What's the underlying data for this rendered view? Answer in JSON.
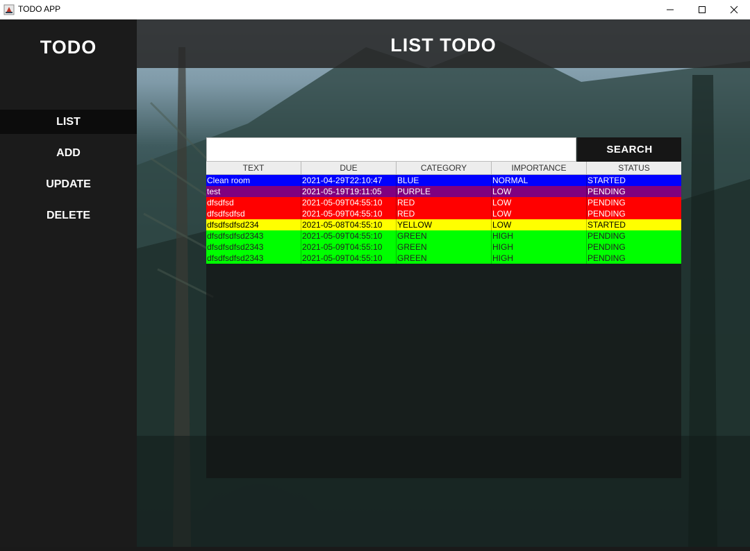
{
  "window": {
    "title": "TODO APP"
  },
  "sidebar": {
    "brand": "TODO",
    "items": [
      {
        "label": "LIST",
        "active": true
      },
      {
        "label": "ADD",
        "active": false
      },
      {
        "label": "UPDATE",
        "active": false
      },
      {
        "label": "DELETE",
        "active": false
      }
    ]
  },
  "main": {
    "title": "LIST TODO",
    "search": {
      "value": "",
      "button_label": "SEARCH"
    }
  },
  "table": {
    "columns": [
      "TEXT",
      "DUE",
      "CATEGORY",
      "IMPORTANCE",
      "STATUS"
    ],
    "rows": [
      {
        "cells": [
          "Clean room",
          "2021-04-29T22:10:47",
          "BLUE",
          "NORMAL",
          "STARTED"
        ],
        "bg": "#0000ff",
        "fg": "#ffffff"
      },
      {
        "cells": [
          "test",
          "2021-05-19T19:11:05",
          "PURPLE",
          "LOW",
          "PENDING"
        ],
        "bg": "#800080",
        "fg": "#ffffff"
      },
      {
        "cells": [
          "dfsdfsd",
          "2021-05-09T04:55:10",
          "RED",
          "LOW",
          "PENDING"
        ],
        "bg": "#ff0000",
        "fg": "#ffffff"
      },
      {
        "cells": [
          "dfsdfsdfsd",
          "2021-05-09T04:55:10",
          "RED",
          "LOW",
          "PENDING"
        ],
        "bg": "#ff0000",
        "fg": "#ffffff"
      },
      {
        "cells": [
          "dfsdfsdfsd234",
          "2021-05-08T04:55:10",
          "YELLOW",
          "LOW",
          "STARTED"
        ],
        "bg": "#ffff00",
        "fg": "#000000"
      },
      {
        "cells": [
          "dfsdfsdfsd2343",
          "2021-05-09T04:55:10",
          "GREEN",
          "HIGH",
          "PENDING"
        ],
        "bg": "#00ff00",
        "fg": "#222222"
      },
      {
        "cells": [
          "dfsdfsdfsd2343",
          "2021-05-09T04:55:10",
          "GREEN",
          "HIGH",
          "PENDING"
        ],
        "bg": "#00ff00",
        "fg": "#222222"
      },
      {
        "cells": [
          "dfsdfsdfsd2343",
          "2021-05-09T04:55:10",
          "GREEN",
          "HIGH",
          "PENDING"
        ],
        "bg": "#00ff00",
        "fg": "#222222"
      }
    ]
  }
}
